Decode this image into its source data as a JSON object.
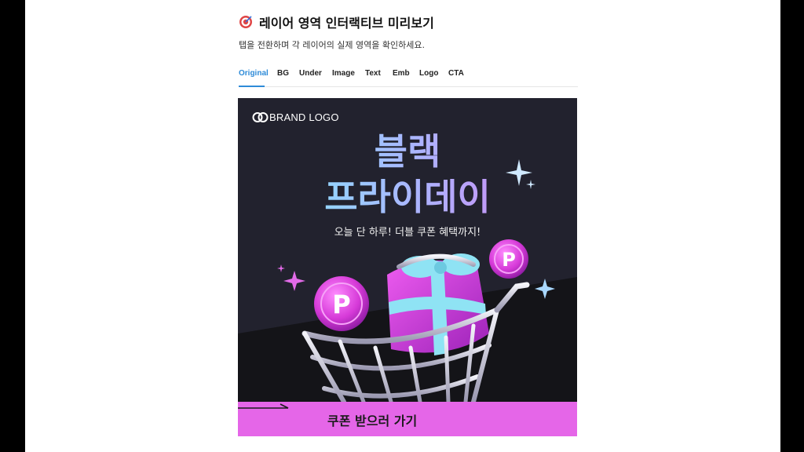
{
  "header": {
    "title": "레이어 영역 인터랙티브 미리보기",
    "title_icon": "target-icon",
    "subtitle": "탭을 전환하며 각 레이어의 실제 영역을 확인하세요."
  },
  "tabs": [
    {
      "label": "Original",
      "active": true
    },
    {
      "label": "BG",
      "active": false
    },
    {
      "label": "Under",
      "active": false
    },
    {
      "label": "Image",
      "active": false
    },
    {
      "label": "Text",
      "active": false
    },
    {
      "label": "Emb",
      "active": false
    },
    {
      "label": "Logo",
      "active": false
    },
    {
      "label": "CTA",
      "active": false
    }
  ],
  "banner": {
    "logo_text": "BRAND LOGO",
    "headline_line1": "블랙",
    "headline_line2": "프라이데이",
    "tagline": "오늘 단 하루! 더블 쿠폰 혜택까지!",
    "coin_letter": "P",
    "cta_label": "쿠폰 받으러 가기",
    "colors": {
      "background": "#22222e",
      "accent_pink": "#e566e8",
      "headline_cyan": "#7ff0ff",
      "headline_purple": "#d87cf0",
      "active_tab": "#2e8bd8"
    }
  }
}
